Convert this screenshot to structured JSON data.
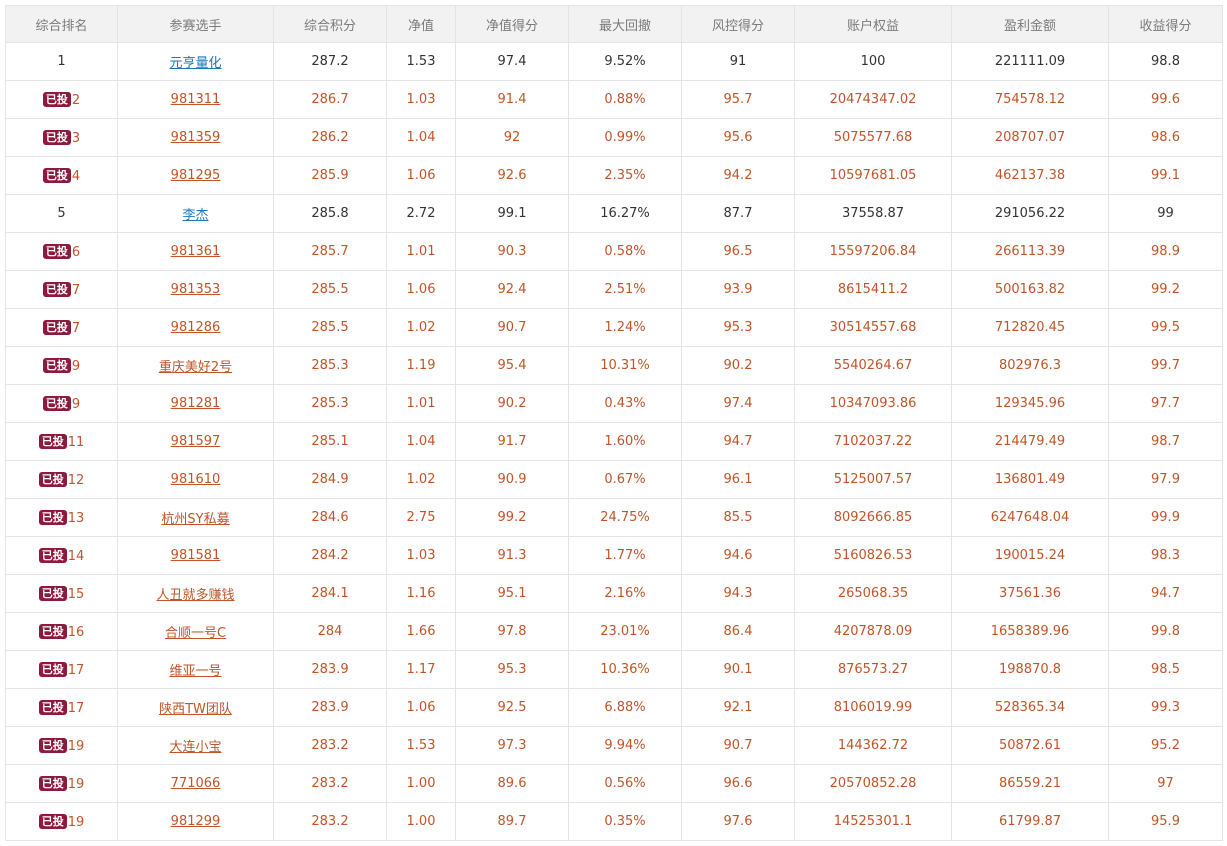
{
  "table": {
    "headers": [
      "综合排名",
      "参赛选手",
      "综合积分",
      "净值",
      "净值得分",
      "最大回撤",
      "风控得分",
      "账户权益",
      "盈利金额",
      "收益得分"
    ],
    "badge_label": "已投",
    "rows": [
      {
        "rank": "1",
        "name": "元亨量化",
        "score": "287.2",
        "nav": "1.53",
        "nav_score": "97.4",
        "drawdown": "9.52%",
        "risk_score": "91",
        "equity": "100",
        "profit": "221111.09",
        "return_score": "98.8",
        "invested": false
      },
      {
        "rank": "2",
        "name": "981311",
        "score": "286.7",
        "nav": "1.03",
        "nav_score": "91.4",
        "drawdown": "0.88%",
        "risk_score": "95.7",
        "equity": "20474347.02",
        "profit": "754578.12",
        "return_score": "99.6",
        "invested": true
      },
      {
        "rank": "3",
        "name": "981359",
        "score": "286.2",
        "nav": "1.04",
        "nav_score": "92",
        "drawdown": "0.99%",
        "risk_score": "95.6",
        "equity": "5075577.68",
        "profit": "208707.07",
        "return_score": "98.6",
        "invested": true
      },
      {
        "rank": "4",
        "name": "981295",
        "score": "285.9",
        "nav": "1.06",
        "nav_score": "92.6",
        "drawdown": "2.35%",
        "risk_score": "94.2",
        "equity": "10597681.05",
        "profit": "462137.38",
        "return_score": "99.1",
        "invested": true
      },
      {
        "rank": "5",
        "name": "李杰",
        "score": "285.8",
        "nav": "2.72",
        "nav_score": "99.1",
        "drawdown": "16.27%",
        "risk_score": "87.7",
        "equity": "37558.87",
        "profit": "291056.22",
        "return_score": "99",
        "invested": false
      },
      {
        "rank": "6",
        "name": "981361",
        "score": "285.7",
        "nav": "1.01",
        "nav_score": "90.3",
        "drawdown": "0.58%",
        "risk_score": "96.5",
        "equity": "15597206.84",
        "profit": "266113.39",
        "return_score": "98.9",
        "invested": true
      },
      {
        "rank": "7",
        "name": "981353",
        "score": "285.5",
        "nav": "1.06",
        "nav_score": "92.4",
        "drawdown": "2.51%",
        "risk_score": "93.9",
        "equity": "8615411.2",
        "profit": "500163.82",
        "return_score": "99.2",
        "invested": true
      },
      {
        "rank": "7",
        "name": "981286",
        "score": "285.5",
        "nav": "1.02",
        "nav_score": "90.7",
        "drawdown": "1.24%",
        "risk_score": "95.3",
        "equity": "30514557.68",
        "profit": "712820.45",
        "return_score": "99.5",
        "invested": true
      },
      {
        "rank": "9",
        "name": "重庆美好2号",
        "score": "285.3",
        "nav": "1.19",
        "nav_score": "95.4",
        "drawdown": "10.31%",
        "risk_score": "90.2",
        "equity": "5540264.67",
        "profit": "802976.3",
        "return_score": "99.7",
        "invested": true
      },
      {
        "rank": "9",
        "name": "981281",
        "score": "285.3",
        "nav": "1.01",
        "nav_score": "90.2",
        "drawdown": "0.43%",
        "risk_score": "97.4",
        "equity": "10347093.86",
        "profit": "129345.96",
        "return_score": "97.7",
        "invested": true
      },
      {
        "rank": "11",
        "name": "981597",
        "score": "285.1",
        "nav": "1.04",
        "nav_score": "91.7",
        "drawdown": "1.60%",
        "risk_score": "94.7",
        "equity": "7102037.22",
        "profit": "214479.49",
        "return_score": "98.7",
        "invested": true
      },
      {
        "rank": "12",
        "name": "981610",
        "score": "284.9",
        "nav": "1.02",
        "nav_score": "90.9",
        "drawdown": "0.67%",
        "risk_score": "96.1",
        "equity": "5125007.57",
        "profit": "136801.49",
        "return_score": "97.9",
        "invested": true
      },
      {
        "rank": "13",
        "name": "杭州SY私募",
        "score": "284.6",
        "nav": "2.75",
        "nav_score": "99.2",
        "drawdown": "24.75%",
        "risk_score": "85.5",
        "equity": "8092666.85",
        "profit": "6247648.04",
        "return_score": "99.9",
        "invested": true
      },
      {
        "rank": "14",
        "name": "981581",
        "score": "284.2",
        "nav": "1.03",
        "nav_score": "91.3",
        "drawdown": "1.77%",
        "risk_score": "94.6",
        "equity": "5160826.53",
        "profit": "190015.24",
        "return_score": "98.3",
        "invested": true
      },
      {
        "rank": "15",
        "name": "人丑就多赚钱",
        "score": "284.1",
        "nav": "1.16",
        "nav_score": "95.1",
        "drawdown": "2.16%",
        "risk_score": "94.3",
        "equity": "265068.35",
        "profit": "37561.36",
        "return_score": "94.7",
        "invested": true
      },
      {
        "rank": "16",
        "name": "合顺一号C",
        "score": "284",
        "nav": "1.66",
        "nav_score": "97.8",
        "drawdown": "23.01%",
        "risk_score": "86.4",
        "equity": "4207878.09",
        "profit": "1658389.96",
        "return_score": "99.8",
        "invested": true
      },
      {
        "rank": "17",
        "name": "维亚一号",
        "score": "283.9",
        "nav": "1.17",
        "nav_score": "95.3",
        "drawdown": "10.36%",
        "risk_score": "90.1",
        "equity": "876573.27",
        "profit": "198870.8",
        "return_score": "98.5",
        "invested": true
      },
      {
        "rank": "17",
        "name": "陕西TW团队",
        "score": "283.9",
        "nav": "1.06",
        "nav_score": "92.5",
        "drawdown": "6.88%",
        "risk_score": "92.1",
        "equity": "8106019.99",
        "profit": "528365.34",
        "return_score": "99.3",
        "invested": true
      },
      {
        "rank": "19",
        "name": "大连小宝",
        "score": "283.2",
        "nav": "1.53",
        "nav_score": "97.3",
        "drawdown": "9.94%",
        "risk_score": "90.7",
        "equity": "144362.72",
        "profit": "50872.61",
        "return_score": "95.2",
        "invested": true
      },
      {
        "rank": "19",
        "name": "771066",
        "score": "283.2",
        "nav": "1.00",
        "nav_score": "89.6",
        "drawdown": "0.56%",
        "risk_score": "96.6",
        "equity": "20570852.28",
        "profit": "86559.21",
        "return_score": "97",
        "invested": true
      },
      {
        "rank": "19",
        "name": "981299",
        "score": "283.2",
        "nav": "1.00",
        "nav_score": "89.7",
        "drawdown": "0.35%",
        "risk_score": "97.6",
        "equity": "14525301.1",
        "profit": "61799.87",
        "return_score": "95.9",
        "invested": true
      }
    ]
  },
  "colors": {
    "header_bg": "#f2f2f2",
    "header_text": "#7a7a7a",
    "border": "#e4e4e4",
    "invested_text": "#c0552a",
    "plain_link": "#1a79b8",
    "badge_bg": "#8b1a3c"
  }
}
